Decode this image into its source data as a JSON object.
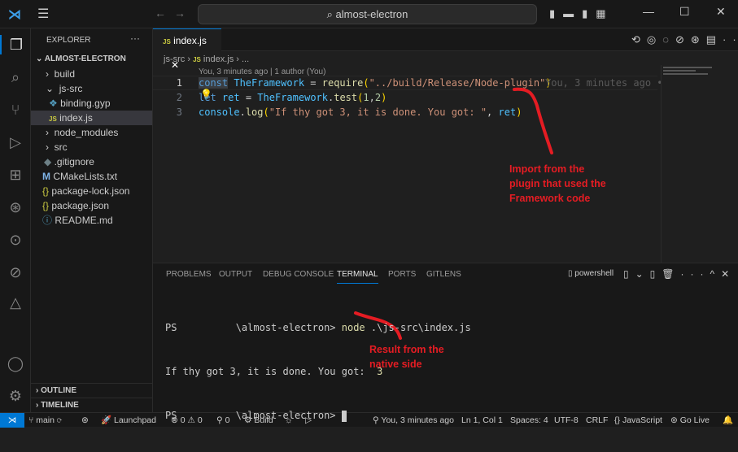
{
  "title": {
    "search": "almost-electron"
  },
  "sidebar": {
    "header": "EXPLORER",
    "root": "ALMOST-ELECTRON",
    "items": [
      {
        "label": "build",
        "type": "folder"
      },
      {
        "label": "js-src",
        "type": "folder-open"
      },
      {
        "label": "binding.gyp",
        "type": "gyp"
      },
      {
        "label": "index.js",
        "type": "js"
      },
      {
        "label": "node_modules",
        "type": "folder"
      },
      {
        "label": "src",
        "type": "folder"
      },
      {
        "label": ".gitignore",
        "type": "git"
      },
      {
        "label": "CMakeLists.txt",
        "type": "cmake"
      },
      {
        "label": "package-lock.json",
        "type": "json"
      },
      {
        "label": "package.json",
        "type": "json"
      },
      {
        "label": "README.md",
        "type": "info"
      }
    ],
    "outline": "OUTLINE",
    "timeline": "TIMELINE"
  },
  "editor": {
    "tab": "index.js",
    "breadcrumb": [
      "js-src",
      "index.js",
      "..."
    ],
    "codelens": "You, 3 minutes ago | 1 author (You)",
    "blame": "You, 3 minutes ago •",
    "lines": [
      {
        "n": "1"
      },
      {
        "n": "2"
      },
      {
        "n": "3"
      }
    ]
  },
  "panel": {
    "tabs": [
      "PROBLEMS",
      "OUTPUT",
      "DEBUG CONSOLE",
      "TERMINAL",
      "PORTS",
      "GITLENS"
    ],
    "active": "TERMINAL",
    "shell": "powershell",
    "terminal": {
      "l1_prompt": "PS          \\almost-electron> ",
      "l1_cmd": "node",
      "l1_args": " .\\js-src\\index.js",
      "l2": "If thy got 3, it is done. You got:  ",
      "l2_val": "3",
      "l3_prompt": "PS          \\almost-electron> "
    }
  },
  "annotations": {
    "import": [
      "Import from the",
      "plugin that used the",
      "Framework code"
    ],
    "result": [
      "Result from the",
      "native side"
    ]
  },
  "status": {
    "branch": "main",
    "launchpad": "Launchpad",
    "errors": "0",
    "warnings": "0",
    "ports": "0",
    "build": "Build",
    "blame": "You, 3 minutes ago",
    "position": "Ln 1, Col 1",
    "spaces": "Spaces: 4",
    "encoding": "UTF-8",
    "eol": "CRLF",
    "language": "JavaScript",
    "golive": "Go Live"
  },
  "colors": {
    "accent": "#0078d4",
    "annotation": "#e51c23"
  }
}
